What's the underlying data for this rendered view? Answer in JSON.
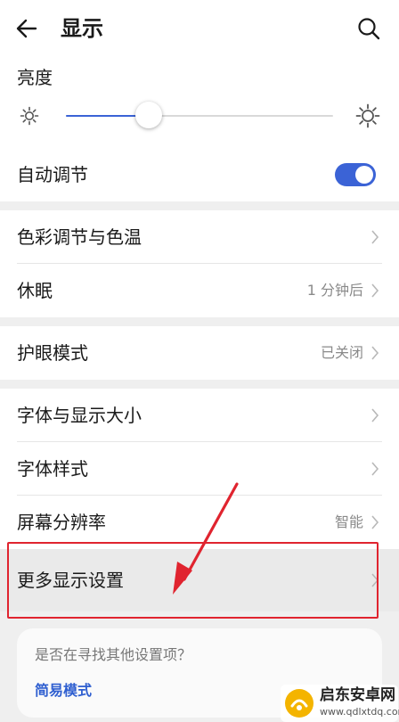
{
  "header": {
    "title": "显示",
    "back_icon": "arrow-left-icon",
    "search_icon": "search-icon"
  },
  "brightness": {
    "label": "亮度",
    "level_percent": 31,
    "low_icon": "sun-small-icon",
    "high_icon": "sun-large-icon"
  },
  "auto_adjust": {
    "label": "自动调节",
    "enabled": true
  },
  "group_color": [
    {
      "label": "色彩调节与色温",
      "value": ""
    },
    {
      "label": "休眠",
      "value": "1 分钟后"
    }
  ],
  "group_eye": [
    {
      "label": "护眼模式",
      "value": "已关闭"
    }
  ],
  "group_font": [
    {
      "label": "字体与显示大小",
      "value": ""
    },
    {
      "label": "字体样式",
      "value": ""
    },
    {
      "label": "屏幕分辨率",
      "value": "智能"
    },
    {
      "label": "更多显示设置",
      "value": ""
    }
  ],
  "suggestion": {
    "question": "是否在寻找其他设置项？",
    "link": "简易模式"
  },
  "watermark": {
    "title": "启东安卓网",
    "url": "www.qdlxtdq.com"
  },
  "colors": {
    "accent": "#3b63d6",
    "annotation": "#e0242f",
    "link": "#2f5fd0"
  }
}
